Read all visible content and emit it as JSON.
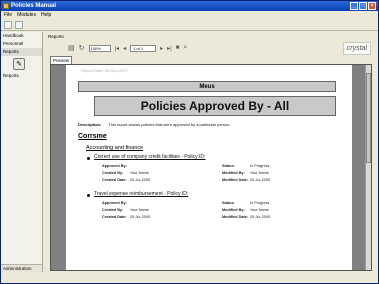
{
  "window": {
    "title": "Policies Manual"
  },
  "menu": [
    "File",
    "Modules",
    "Help"
  ],
  "sidebar": {
    "items": [
      "Handbook",
      "Personnel",
      "Reports"
    ],
    "active_icon_label": "Reports",
    "bottom": "Administration"
  },
  "content": {
    "label": "Reports"
  },
  "viewer": {
    "zoom": "100%",
    "page": "1 of 1",
    "brand": "crystal",
    "preview_tab": "Preview"
  },
  "report": {
    "date": "Report Date: 06-Sep-2007",
    "band": "Meus",
    "title": "Policies Approved By - All",
    "description_label": "Description:",
    "description_text": "This report shows policies that were approved by a particular person.",
    "section": "Corrsme",
    "subsection": "Accounting and finance",
    "policies": [
      {
        "title": "Correct use of company credit facilities - Policy ID:",
        "approved_by_label": "Approved By:",
        "created_by_label": "Created By:",
        "created_by": "Your Name",
        "created_date_label": "Created Date:",
        "created_date": "25-Jul-2005",
        "status_label": "Status:",
        "status": "In Progress",
        "modified_by_label": "Modified By:",
        "modified_by": "Your Name",
        "modified_date_label": "Modified Date:",
        "modified_date": "25-Jul-2005"
      },
      {
        "title": "Travel expense reimbursement - Policy ID:",
        "approved_by_label": "Approved By:",
        "created_by_label": "Created By:",
        "created_by": "Your Name",
        "created_date_label": "Created Date:",
        "created_date": "25-Jul-2005",
        "status_label": "Status:",
        "status": "In Progress",
        "modified_by_label": "Modified By:",
        "modified_by": "Your Name",
        "modified_date_label": "Modified Date:",
        "modified_date": "25-Jul-2005"
      }
    ]
  }
}
